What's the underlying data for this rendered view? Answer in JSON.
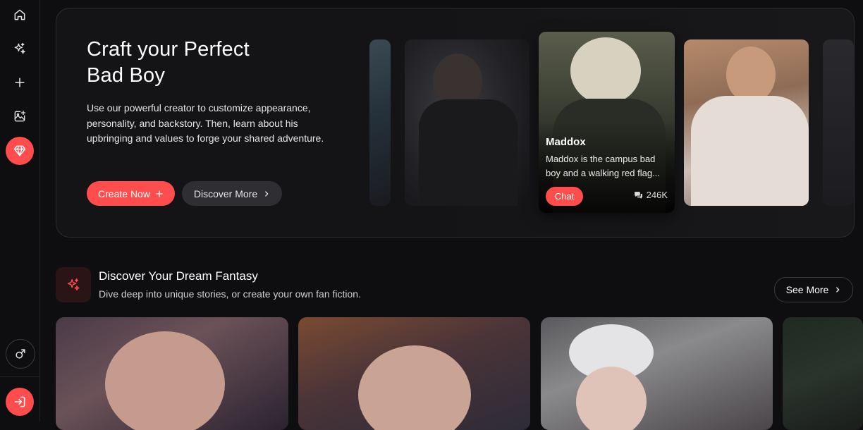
{
  "sidebar": {
    "items": [
      {
        "icon": "home-icon"
      },
      {
        "icon": "sparkles-icon"
      },
      {
        "icon": "plus-icon"
      },
      {
        "icon": "image-add-icon"
      },
      {
        "icon": "diamond-icon"
      },
      {
        "icon": "male-gender-icon"
      },
      {
        "icon": "login-icon"
      }
    ]
  },
  "hero": {
    "title": "Craft your Perfect\nBad Boy",
    "description": "Use our powerful creator to customize appearance, personality, and backstory. Then, learn about his upbringing and values to forge your shared adventure.",
    "create_label": "Create Now",
    "discover_label": "Discover More",
    "featured": {
      "name": "Maddox",
      "description": "Maddox is the campus bad boy and a walking red flag...",
      "chat_label": "Chat",
      "count": "246K"
    }
  },
  "section": {
    "title": "Discover Your Dream Fantasy",
    "subtitle": "Dive deep into unique stories, or create your own fan fiction.",
    "see_more_label": "See More"
  },
  "colors": {
    "accent": "#ff4d4d",
    "background": "#0e0e10"
  }
}
